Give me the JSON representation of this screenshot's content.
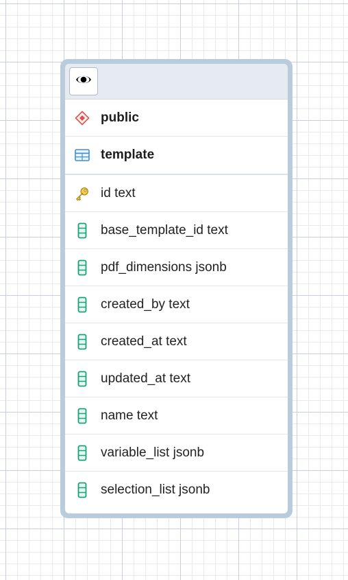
{
  "schema": {
    "name": "public",
    "icon": "schema-diamond-icon",
    "icon_color": "#d9534f"
  },
  "table": {
    "name": "template",
    "icon": "table-icon",
    "icon_color": "#3d8fd1"
  },
  "header": {
    "toggle_icon": "eye-icon"
  },
  "columns": [
    {
      "name": "id text",
      "icon": "primary-key-icon",
      "color": "#e2b323"
    },
    {
      "name": "base_template_id text",
      "icon": "column-icon",
      "color": "#1aa37a"
    },
    {
      "name": "pdf_dimensions jsonb",
      "icon": "column-icon",
      "color": "#1aa37a"
    },
    {
      "name": "created_by text",
      "icon": "column-icon",
      "color": "#1aa37a"
    },
    {
      "name": "created_at text",
      "icon": "column-icon",
      "color": "#1aa37a"
    },
    {
      "name": "updated_at text",
      "icon": "column-icon",
      "color": "#1aa37a"
    },
    {
      "name": "name text",
      "icon": "column-icon",
      "color": "#1aa37a"
    },
    {
      "name": "variable_list jsonb",
      "icon": "column-icon",
      "color": "#1aa37a"
    },
    {
      "name": "selection_list jsonb",
      "icon": "column-icon",
      "color": "#1aa37a"
    }
  ],
  "colors": {
    "node_border": "#b9cbdd",
    "header_bg": "#e6eaf1",
    "grid_major": "#c9cddd",
    "grid_minor": "#e8e9ef"
  }
}
